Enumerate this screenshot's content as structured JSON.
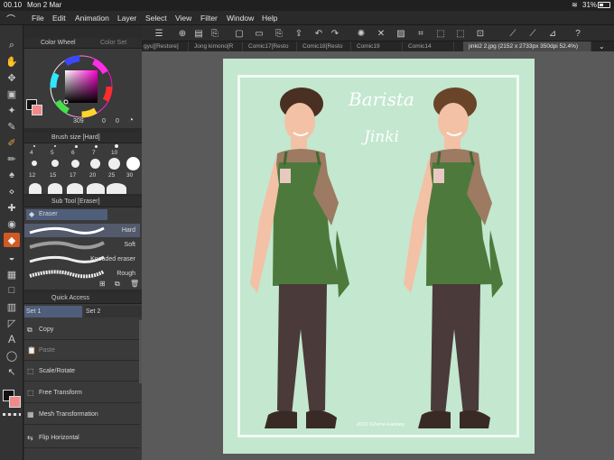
{
  "status": {
    "time": "00.10",
    "date": "Mon 2 Mar",
    "battery": "31%"
  },
  "menu": [
    "File",
    "Edit",
    "Animation",
    "Layer",
    "Select",
    "View",
    "Filter",
    "Window",
    "Help"
  ],
  "color_panel": {
    "tab_active": "Color Wheel",
    "tab_inactive": "Color Set",
    "hue": "309",
    "sat": "0",
    "val": "0",
    "main_color": "#111111",
    "sub_color": "#f08a8a"
  },
  "brush_size": {
    "title": "Brush size [Hard]",
    "sizes": [
      "4",
      "5",
      "6",
      "7",
      "10",
      "12",
      "15",
      "17",
      "20",
      "25",
      "30"
    ]
  },
  "subtool": {
    "title": "Sub Tool [Eraser]",
    "group": "Eraser",
    "items": [
      "Hard",
      "Soft",
      "Kneaded eraser",
      "Rough"
    ]
  },
  "quick_access": {
    "title": "Quick Access",
    "sets": [
      "Set 1",
      "Set 2"
    ],
    "items": [
      "Copy",
      "Paste",
      "Scale/Rotate",
      "Free Transform",
      "Mesh Transformation",
      "Flip Horizontal"
    ]
  },
  "tabs": [
    "gyu][Restore]",
    "Jong kimono[R",
    "Comic17[Resto",
    "Comic18[Resto",
    "Comic19",
    "Comic14",
    "jinki2 2.jpg (2152 x 2733px 350dpi 52.4%)"
  ],
  "artwork": {
    "title_script": "Barista",
    "name_script": "Jinki",
    "signature": "2019 ©Zume-Fantasy",
    "bg_color": "#c3e7cf"
  }
}
